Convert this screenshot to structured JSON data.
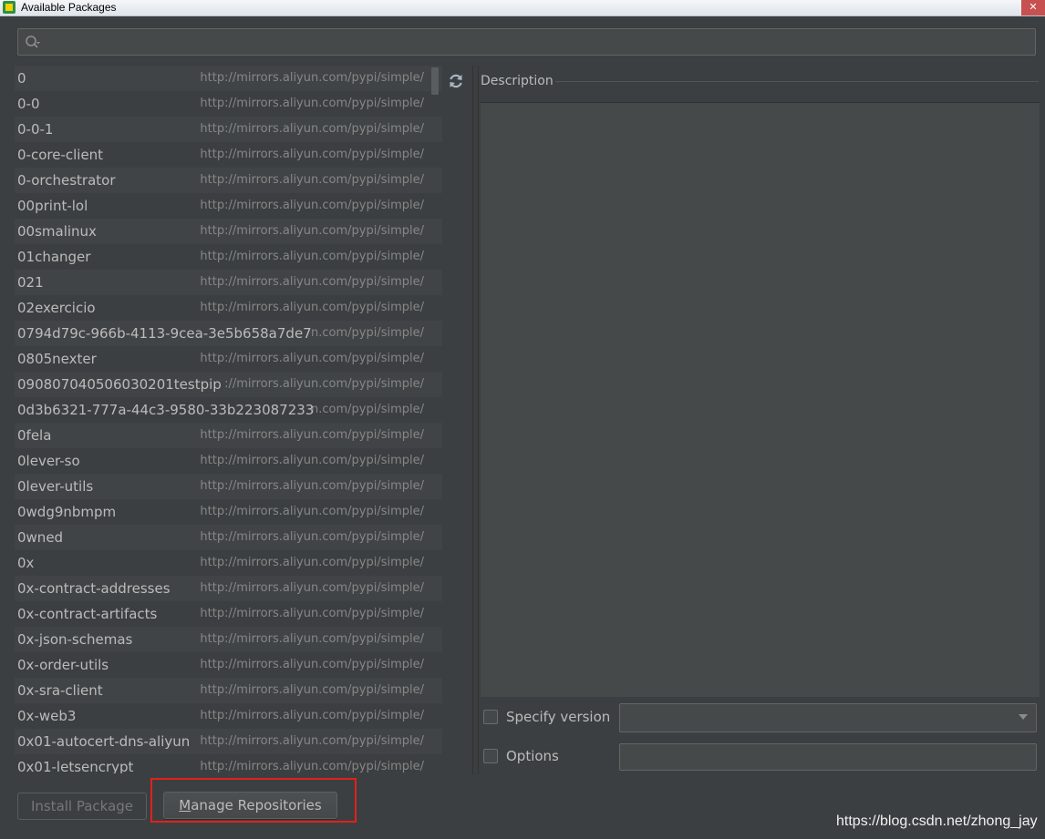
{
  "window": {
    "title": "Available Packages",
    "close_glyph": "✕"
  },
  "search": {
    "placeholder": "",
    "value": ""
  },
  "packages": [
    {
      "name": "0",
      "repo": "http://mirrors.aliyun.com/pypi/simple/"
    },
    {
      "name": "0-0",
      "repo": "http://mirrors.aliyun.com/pypi/simple/"
    },
    {
      "name": "0-0-1",
      "repo": "http://mirrors.aliyun.com/pypi/simple/"
    },
    {
      "name": "0-core-client",
      "repo": "http://mirrors.aliyun.com/pypi/simple/"
    },
    {
      "name": "0-orchestrator",
      "repo": "http://mirrors.aliyun.com/pypi/simple/"
    },
    {
      "name": "00print-lol",
      "repo": "http://mirrors.aliyun.com/pypi/simple/"
    },
    {
      "name": "00smalinux",
      "repo": "http://mirrors.aliyun.com/pypi/simple/"
    },
    {
      "name": "01changer",
      "repo": "http://mirrors.aliyun.com/pypi/simple/"
    },
    {
      "name": "021",
      "repo": "http://mirrors.aliyun.com/pypi/simple/"
    },
    {
      "name": "02exercicio",
      "repo": "http://mirrors.aliyun.com/pypi/simple/"
    },
    {
      "name": "0794d79c-966b-4113-9cea-3e5b658a7de7",
      "repo": "n.com/pypi/simple/"
    },
    {
      "name": "0805nexter",
      "repo": "http://mirrors.aliyun.com/pypi/simple/"
    },
    {
      "name": "090807040506030201testpip",
      "repo": "://mirrors.aliyun.com/pypi/simple/"
    },
    {
      "name": "0d3b6321-777a-44c3-9580-33b223087233",
      "repo": "n.com/pypi/simple/"
    },
    {
      "name": "0fela",
      "repo": "http://mirrors.aliyun.com/pypi/simple/"
    },
    {
      "name": "0lever-so",
      "repo": "http://mirrors.aliyun.com/pypi/simple/"
    },
    {
      "name": "0lever-utils",
      "repo": "http://mirrors.aliyun.com/pypi/simple/"
    },
    {
      "name": "0wdg9nbmpm",
      "repo": "http://mirrors.aliyun.com/pypi/simple/"
    },
    {
      "name": "0wned",
      "repo": "http://mirrors.aliyun.com/pypi/simple/"
    },
    {
      "name": "0x",
      "repo": "http://mirrors.aliyun.com/pypi/simple/"
    },
    {
      "name": "0x-contract-addresses",
      "repo": "http://mirrors.aliyun.com/pypi/simple/"
    },
    {
      "name": "0x-contract-artifacts",
      "repo": "http://mirrors.aliyun.com/pypi/simple/"
    },
    {
      "name": "0x-json-schemas",
      "repo": "http://mirrors.aliyun.com/pypi/simple/"
    },
    {
      "name": "0x-order-utils",
      "repo": "http://mirrors.aliyun.com/pypi/simple/"
    },
    {
      "name": "0x-sra-client",
      "repo": "http://mirrors.aliyun.com/pypi/simple/"
    },
    {
      "name": "0x-web3",
      "repo": "http://mirrors.aliyun.com/pypi/simple/"
    },
    {
      "name": "0x01-autocert-dns-aliyun",
      "repo": "http://mirrors.aliyun.com/pypi/simple/"
    },
    {
      "name": "0x01-letsencrypt",
      "repo": "http://mirrors.aliyun.com/pypi/simple/"
    }
  ],
  "description": {
    "label": "Description",
    "text": ""
  },
  "options": {
    "specify_version_label": "Specify version",
    "specify_version_checked": false,
    "version_value": "",
    "options_label": "Options",
    "options_checked": false,
    "options_value": ""
  },
  "buttons": {
    "install": "Install Package",
    "manage_prefix": "M",
    "manage_rest": "anage Repositories"
  },
  "watermark": "https://blog.csdn.net/zhong_jay",
  "icons": {
    "search": "search-icon",
    "refresh": "refresh-icon",
    "dropdown": "chevron-down-icon"
  },
  "colors": {
    "highlight": "#e0211a",
    "background": "#3c3f41"
  }
}
